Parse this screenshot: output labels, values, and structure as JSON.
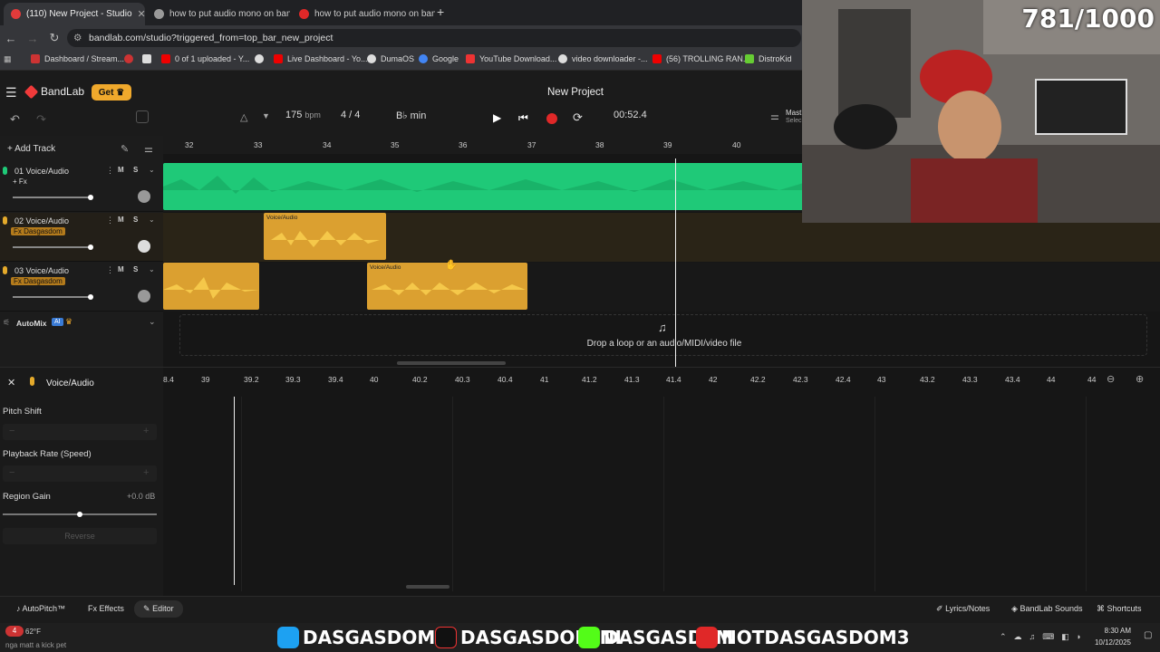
{
  "browser": {
    "tabs": [
      {
        "label": "(110) New Project - Studio",
        "active": true
      },
      {
        "label": "how to put audio mono on ban",
        "active": false
      },
      {
        "label": "how to put audio mono on ban",
        "active": false
      }
    ],
    "url": "bandlab.com/studio?triggered_from=top_bar_new_project",
    "bookmarks": [
      "Dashboard / Stream...",
      "0 of 1 uploaded - Y...",
      "Live Dashboard - Yo...",
      "DumaOS",
      "Google",
      "YouTube Download...",
      "video downloader -...",
      "(56) TROLLING RAN...",
      "DistroKid"
    ]
  },
  "app": {
    "brand": "BandLab",
    "get_label": "Get",
    "project_title": "New Project",
    "bpm": "175",
    "bpm_unit": "bpm",
    "time_sig": "4 / 4",
    "key": "B♭ min",
    "time": "00:52.4",
    "master_label": "Mast",
    "master_sub": "Selec"
  },
  "timeline": {
    "ruler": [
      "32",
      "33",
      "34",
      "35",
      "36",
      "37",
      "38",
      "39",
      "40"
    ]
  },
  "tracks": [
    {
      "name": "01  Voice/Audio",
      "fx": "+ Fx",
      "color": "#1fc978"
    },
    {
      "name": "02  Voice/Audio",
      "fx": "Fx Dasgasdom",
      "color": "#e4aa2b"
    },
    {
      "name": "03  Voice/Audio",
      "fx": "Fx Dasgasdom",
      "color": "#e4aa2b"
    }
  ],
  "region_label": "Voice/Audio",
  "add_track_label": "Add Track",
  "automix": {
    "label": "AutoMix",
    "ai_badge": "AI"
  },
  "dropzone_text": "Drop a loop or an audio/MIDI/video file",
  "editor": {
    "title": "Voice/Audio",
    "ruler": [
      "8.4",
      "39",
      "39.2",
      "39.3",
      "39.4",
      "40",
      "40.2",
      "40.3",
      "40.4",
      "41",
      "41.2",
      "41.3",
      "41.4",
      "42",
      "42.2",
      "42.3",
      "42.4",
      "43",
      "43.2",
      "43.3",
      "43.4",
      "44",
      "44"
    ],
    "pitch_shift_label": "Pitch Shift",
    "playback_rate_label": "Playback Rate (Speed)",
    "region_gain_label": "Region Gain",
    "region_gain_value": "+0.0 dB",
    "reverse_label": "Reverse"
  },
  "bottom": {
    "autopitch": "AutoPitch™",
    "effects": "Effects",
    "editor": "Editor",
    "lyrics": "Lyrics/Notes",
    "sounds": "BandLab Sounds",
    "shortcuts": "Shortcuts"
  },
  "stream": {
    "counter": "781/1000",
    "handles": [
      "DASGASDOM3",
      "DASGASDOMINI",
      "DASGASD3M",
      "NOTDASGASDOM3"
    ],
    "weather": "62°F",
    "ticker": "nga matt a kick pet",
    "clock_time": "8:30 AM",
    "clock_date": "10/12/2025",
    "notif_count": "4"
  }
}
